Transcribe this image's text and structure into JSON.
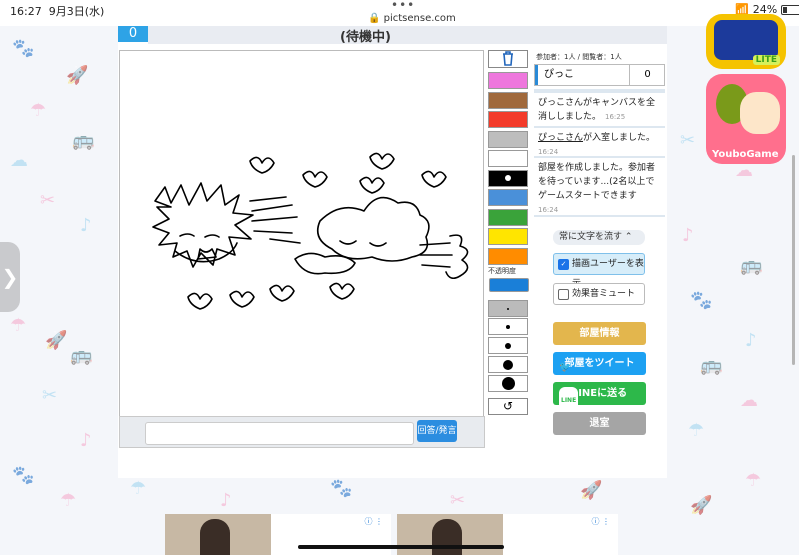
{
  "status": {
    "time": "16:27",
    "date": "9月3日(水)",
    "url": "pictsense.com",
    "battery": "24%",
    "menu_dots": "•••"
  },
  "room": {
    "score_tab": "0",
    "title": "(待機中)",
    "participants": "参加者：1人 / 閲覧者：1人",
    "player": {
      "name": "ぴっこ",
      "score": "0"
    }
  },
  "chat": [
    {
      "text": "ぴっこさんがキャンバスを全消ししました。",
      "time": "16:25"
    },
    {
      "user": "ぴっこさん",
      "text": "が入室しました。",
      "time": "16:24"
    },
    {
      "text": "部屋を作成しました。参加者を待っています...(2名以上でゲームスタートできます",
      "time": "16:24"
    }
  ],
  "answer": {
    "button": "回答/発言",
    "placeholder": ""
  },
  "palette": [
    "#ee77dd",
    "#a0693c",
    "#f33b2a",
    "#bdbdbd",
    "#ffffff",
    "#000000",
    "#4a90d9",
    "#3aa33a",
    "#ffe500",
    "#ff8c00"
  ],
  "opacity_label": "不透明度",
  "side": {
    "stream_select": "常に文字を流す",
    "show_drawer": "描画ユーザーを表示",
    "mute_sfx": "効果音ミュート",
    "room_info": "部屋情報",
    "tweet": "部屋をツイート",
    "line": "LINEに送る",
    "leave": "退室"
  },
  "apps": {
    "youbo": "YouboGame",
    "lite": "LITE"
  },
  "colors": {
    "accent": "#2ea3e6",
    "room_info": "#e3b64d",
    "tweet": "#1da1f2",
    "line": "#2db84a",
    "leave": "#a5a5a5"
  }
}
